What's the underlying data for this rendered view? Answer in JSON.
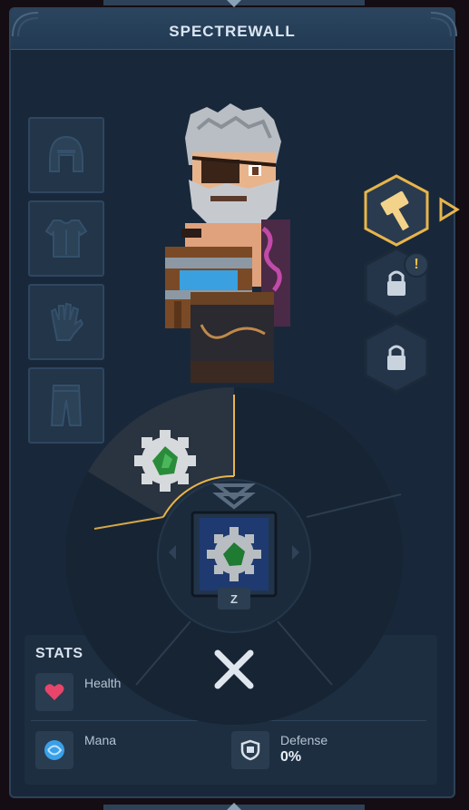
{
  "title": "SPECTREWALL",
  "equipment_slots": [
    {
      "name": "helmet",
      "icon": "helmet-icon"
    },
    {
      "name": "chest",
      "icon": "chest-armor-icon"
    },
    {
      "name": "gloves",
      "icon": "glove-icon"
    },
    {
      "name": "pants",
      "icon": "pants-icon"
    }
  ],
  "ability_slots": [
    {
      "icon": "hammer-icon",
      "state": "selected"
    },
    {
      "icon": "lock-icon",
      "state": "locked"
    },
    {
      "icon": "lock-icon",
      "state": "locked"
    }
  ],
  "alert_badge": "!",
  "radial_menu": {
    "selected_item_icon": "gear-gem-icon",
    "center_item_icon": "gear-gem-icon",
    "hotkey": "Z"
  },
  "stats": {
    "title": "STATS",
    "health": {
      "label": "Health",
      "icon": "heart-icon"
    },
    "mana": {
      "label": "Mana",
      "icon": "mana-orb-icon"
    },
    "defense": {
      "label": "Defense",
      "value": "0%",
      "icon": "shield-icon"
    }
  },
  "colors": {
    "accent_gold": "#e8b54a",
    "panel_bg": "#18283a",
    "health": "#e8456a",
    "mana": "#3aa0e8"
  }
}
